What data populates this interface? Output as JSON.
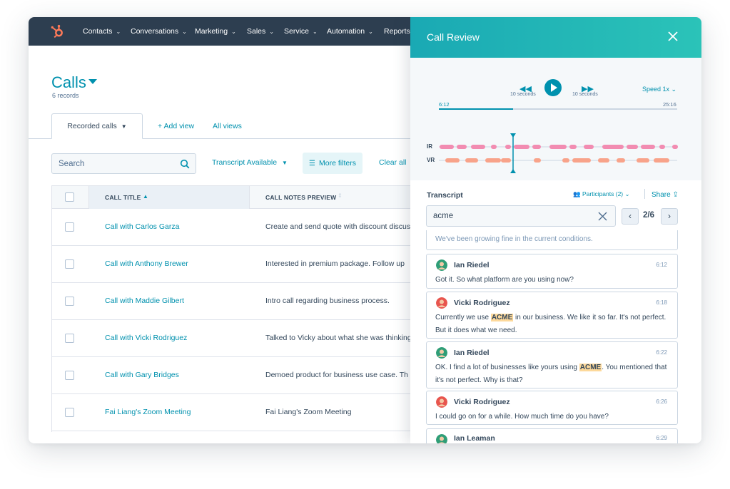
{
  "nav": {
    "items": [
      "Contacts",
      "Conversations",
      "Marketing",
      "Sales",
      "Service",
      "Automation",
      "Reports"
    ]
  },
  "page": {
    "title": "Calls",
    "records": "6 records"
  },
  "tabs": {
    "recorded": "Recorded calls",
    "add_view": "+ Add view",
    "all_views": "All views"
  },
  "filters": {
    "search_placeholder": "Search",
    "transcript": "Transcript Available",
    "more_filters": "More filters",
    "clear_all": "Clear all"
  },
  "table": {
    "columns": [
      "CALL TITLE",
      "CALL NOTES PREVIEW"
    ],
    "rows": [
      {
        "title": "Call with Carlos Garza",
        "preview": "Create and send quote with discount discus"
      },
      {
        "title": "Call with Anthony Brewer",
        "preview": "Interested in premium package. Follow up"
      },
      {
        "title": "Call with Maddie Gilbert",
        "preview": "Intro call regarding business process."
      },
      {
        "title": "Call with Vicki Rodriguez",
        "preview": "Talked to Vicky about what she was thinking"
      },
      {
        "title": "Call with Gary Bridges",
        "preview": "Demoed product for business use case. Th"
      },
      {
        "title": "Fai Liang's Zoom Meeting",
        "preview": "Fai Liang's Zoom Meeting"
      }
    ]
  },
  "panel": {
    "title": "Call Review",
    "player": {
      "back_label": "10 seconds",
      "fwd_label": "10 seconds",
      "speed": "Speed 1x",
      "current_time": "6:12",
      "total_time": "25:16",
      "progress": 0.31,
      "tracks": [
        "IR",
        "VR"
      ]
    },
    "transcript": {
      "label": "Transcript",
      "participants": "Participants (2)",
      "share": "Share",
      "search_value": "acme",
      "match_count": "2/6",
      "fragment": "We've been growing fine in the current conditions.",
      "messages": [
        {
          "speaker": "Ian Riedel",
          "time": "6:12",
          "pre": "Got it. So what platform are you using now?",
          "hl": "",
          "post": ""
        },
        {
          "speaker": "Vicki Rodriguez",
          "time": "6:18",
          "pre": "Currently we use ",
          "hl": "ACME",
          "post": " in our business. We like it so far. It's not perfect. But it does what we need."
        },
        {
          "speaker": "Ian Riedel",
          "time": "6:22",
          "pre": "OK. I find a lot of businesses like yours using ",
          "hl": "ACME",
          "post": ". You mentioned that it's not perfect. Why is that?"
        },
        {
          "speaker": "Vicki Rodriguez",
          "time": "6:26",
          "pre": "I could go on for a while. How much time do you have?",
          "hl": "",
          "post": ""
        },
        {
          "speaker": "Ian Leaman",
          "time": "6:29",
          "pre": "",
          "hl": "",
          "post": ""
        }
      ]
    }
  },
  "colors": {
    "nav_bg": "#2d3e50",
    "accent": "#0091ae",
    "track_ir": "#f28cb1",
    "track_vr": "#f8a38a",
    "highlight": "#fdd99b"
  }
}
